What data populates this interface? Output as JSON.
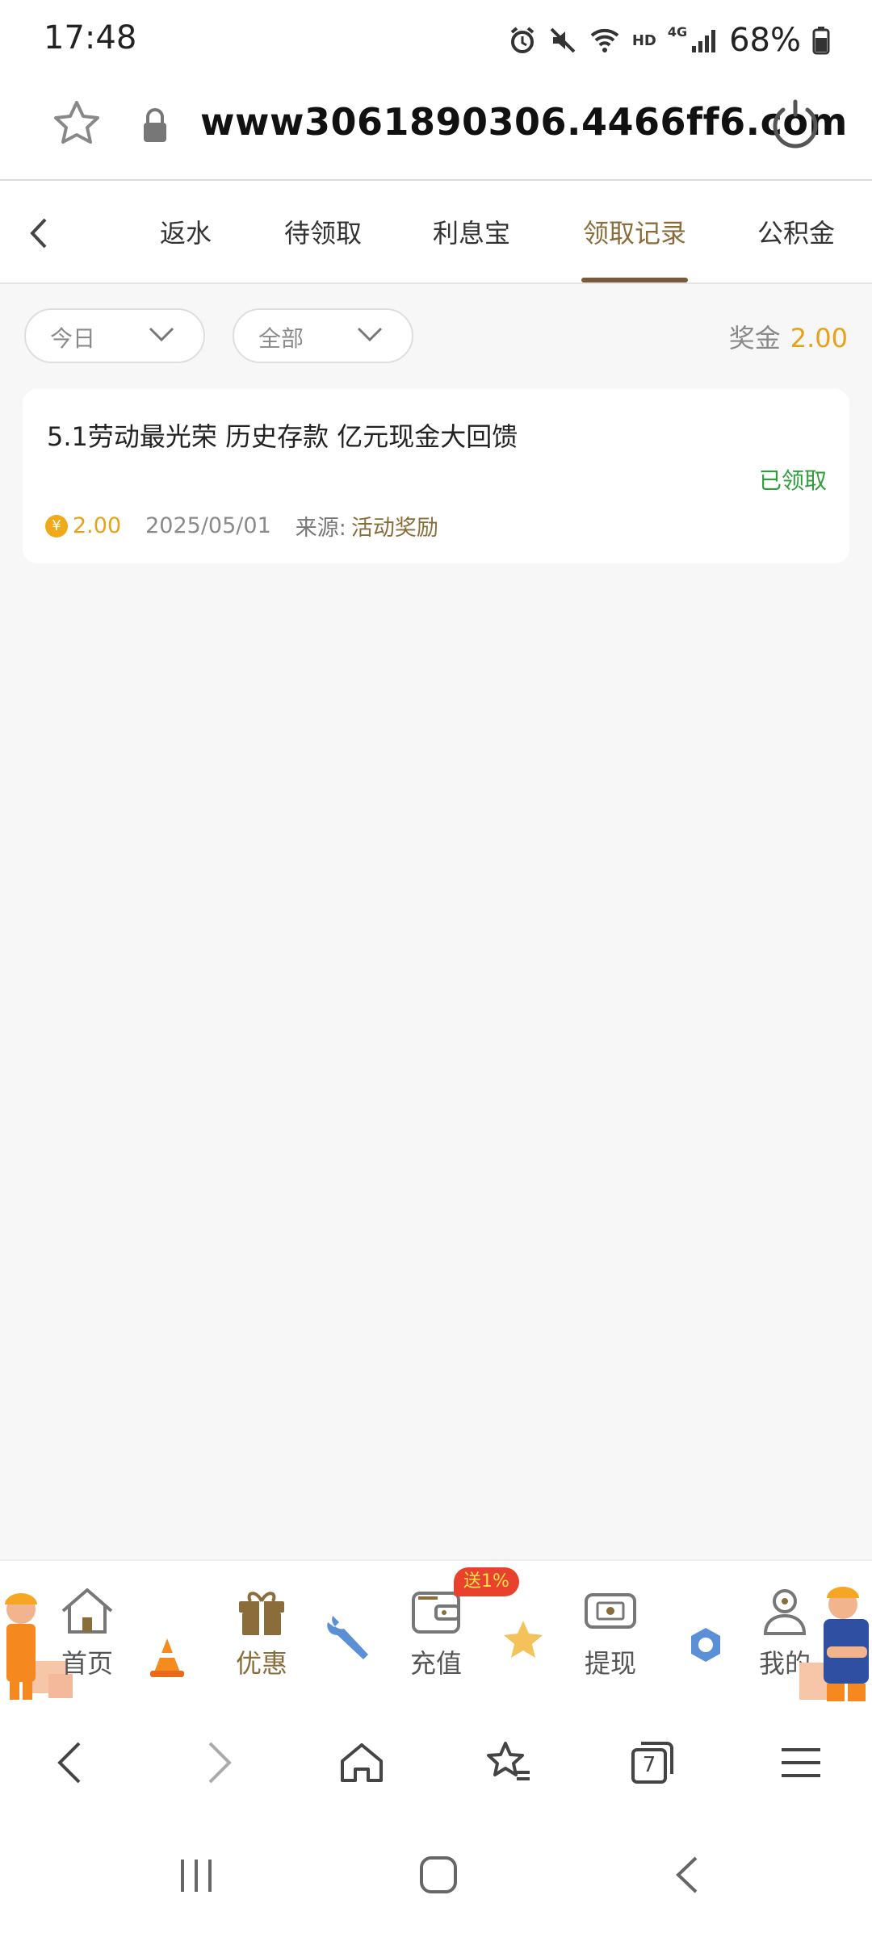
{
  "status_bar": {
    "time": "17:48",
    "battery": "68%",
    "icons": [
      "alarm-icon",
      "mute-icon",
      "wifi-icon",
      "hd-icon",
      "4g-signal-icon",
      "battery-icon"
    ],
    "hd": "HD",
    "network": "4G"
  },
  "url_bar": {
    "url": "www3061890306.4466ff6.com"
  },
  "tabs": {
    "items": [
      {
        "label": "返水"
      },
      {
        "label": "待领取"
      },
      {
        "label": "利息宝"
      },
      {
        "label": "领取记录"
      },
      {
        "label": "公积金"
      }
    ],
    "active_index": 3
  },
  "filters": {
    "date": "今日",
    "type": "全部",
    "bonus_label": "奖金",
    "bonus_value": "2.00"
  },
  "records": [
    {
      "title": "5.1劳动最光荣 历史存款 亿元现金大回馈",
      "status": "已领取",
      "coin_symbol": "¥",
      "amount": "2.00",
      "date": "2025/05/01",
      "source_label": "来源:",
      "source": "活动奖励"
    }
  ],
  "app_nav": {
    "items": [
      {
        "label": "首页"
      },
      {
        "label": "优惠"
      },
      {
        "label": "充值"
      },
      {
        "label": "提现"
      },
      {
        "label": "我的"
      }
    ],
    "active_index": 1,
    "recharge_badge": "送1%"
  },
  "browser_bar": {
    "tab_count": "7"
  },
  "colors": {
    "accent": "#8a6d3b",
    "amount": "#e6a21a",
    "success": "#2e9e3a",
    "badge": "#e8422f"
  }
}
